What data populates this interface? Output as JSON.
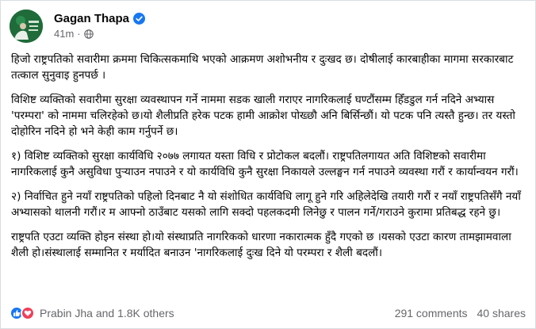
{
  "post": {
    "author": "Gagan Thapa",
    "time": "41m",
    "separator": "·",
    "paragraphs": [
      "हिजो राष्ट्रपतिको सवारीमा क्रममा चिकित्सकमाथि भएको आक्रमण अशोभनीय र दुःखद छ। दोषीलाई कारबाहीका मागमा सरकारबाट तत्काल सुनुवाइ हुनपर्छ ।",
      "विशिष्ट व्यक्तिको सवारीमा सुरक्षा व्यवस्थापन गर्ने नाममा सडक खाली गराएर नागरिकलाई घण्टौंसम्म हिँडडुल गर्न नदिने अभ्यास 'परम्परा' को नाममा चलिरहेको छ।यो शैलीप्रति हरेक पटक हामी आक्रोश पोख्छौ अनि बिर्सिन्छौं। यो पटक पनि त्यस्तै हुन्छ। तर यस्तो दोहोरिन नदिने हो भने केही काम गर्नुपर्ने छ।",
      "१) विशिष्ट व्यक्तिको सुरक्षा कार्यविधि २०७७ लगायत यस्ता विधि र प्रोटोकल बदलौं। राष्ट्रपतिलगायत अति विशिष्टको सवारीमा नागरिकलाई कुनै असुविधा पुर्‍याउन नपाउने र यो कार्यविधि कुनै सुरक्षा निकायले उल्लङ्घन गर्न नपाउने व्यवस्था गरौं र कार्यान्वयन गरौं।",
      "२) निर्वाचित हुने नयाँ राष्ट्रपतिको पहिलो दिनबाट नै यो संशोधित कार्यविधि लागू हुने गरि अहिलेदेखि तयारी गरौं र नयाँ राष्ट्रपतिसँगै नयाँ अभ्यासको थालनी गरौं।र म आफ्नो ठाउँबाट यसको लागि सक्दो पहलकदमी लिनेछु र पालन गर्ने/गराउने कुरामा प्रतिबद्ध रहने छु।",
      "राष्ट्रपति एउटा व्यक्ति होइन संस्था हो।यो संस्थाप्रति नागरिकको धारणा नकारात्मक हुँदै गएको छ ।यसको एउटा कारण तामझामवाला शैली हो।संस्थालाई सम्मानित र मर्यादित बनाउन 'नागरिकलाई दुःख दिने यो परम्परा र शैली बदलौं।"
    ],
    "reactions_label": "Prabin Jha and 1.8K others",
    "comments": "291 comments",
    "shares": "40 shares"
  },
  "colors": {
    "like": "#1877f2",
    "love": "#f33e58",
    "verified": "#1877f2",
    "avatar": "#1f6b3a"
  },
  "icons": [
    "avatar",
    "verified-icon",
    "globe-icon",
    "like-icon",
    "love-icon"
  ]
}
